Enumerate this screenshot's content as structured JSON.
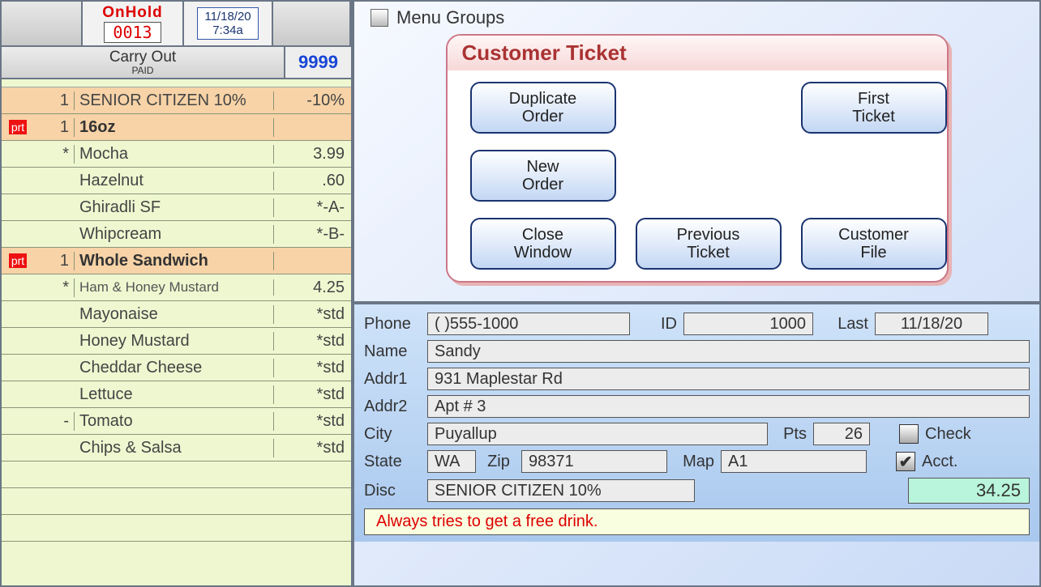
{
  "header": {
    "status": "OnHold",
    "ticket_no": "0013",
    "date": "11/18/20",
    "time": "7:34a"
  },
  "order": {
    "type": "Carry Out",
    "paid": "PAID",
    "code": "9999"
  },
  "lines": [
    {
      "flag": "",
      "qty": "1",
      "name": "SENIOR CITIZEN 10%",
      "price": "-10%",
      "hl": "orange",
      "bold": false
    },
    {
      "flag": "prt",
      "qty": "1",
      "name": "16oz",
      "price": "",
      "hl": "orange",
      "bold": true
    },
    {
      "flag": "",
      "qty": "*",
      "name": "Mocha",
      "price": "3.99",
      "hl": "green",
      "bold": false
    },
    {
      "flag": "",
      "qty": "",
      "name": "Hazelnut",
      "price": ".60",
      "hl": "green",
      "bold": false
    },
    {
      "flag": "",
      "qty": "",
      "name": "Ghiradli SF",
      "price": "*-A-",
      "hl": "green",
      "bold": false
    },
    {
      "flag": "",
      "qty": "",
      "name": "Whipcream",
      "price": "*-B-",
      "hl": "green",
      "bold": false
    },
    {
      "flag": "prt",
      "qty": "1",
      "name": "Whole Sandwich",
      "price": "",
      "hl": "orange",
      "bold": true
    },
    {
      "flag": "",
      "qty": "*",
      "name": "Ham & Honey Mustard",
      "price": "4.25",
      "hl": "green",
      "sub": true
    },
    {
      "flag": "",
      "qty": "",
      "name": "Mayonaise",
      "price": "*std",
      "hl": "green",
      "bold": false
    },
    {
      "flag": "",
      "qty": "",
      "name": "Honey Mustard",
      "price": "*std",
      "hl": "green",
      "bold": false
    },
    {
      "flag": "",
      "qty": "",
      "name": "Cheddar Cheese",
      "price": "*std",
      "hl": "green",
      "bold": false
    },
    {
      "flag": "",
      "qty": "",
      "name": "Lettuce",
      "price": "*std",
      "hl": "green",
      "bold": false
    },
    {
      "flag": "",
      "qty": "-",
      "name": "Tomato",
      "price": "*std",
      "hl": "green",
      "bold": false
    },
    {
      "flag": "",
      "qty": "",
      "name": "Chips & Salsa",
      "price": "*std",
      "hl": "green",
      "bold": false
    },
    {
      "flag": "",
      "qty": "",
      "name": "",
      "price": "",
      "hl": "green"
    },
    {
      "flag": "",
      "qty": "",
      "name": "",
      "price": "",
      "hl": "green"
    },
    {
      "flag": "",
      "qty": "",
      "name": "",
      "price": "",
      "hl": "green"
    }
  ],
  "menu_groups_label": "Menu Groups",
  "ticket_panel": {
    "title": "Customer Ticket",
    "buttons": {
      "dup": "Duplicate\nOrder",
      "first": "First\nTicket",
      "new": "New\nOrder",
      "close": "Close\nWindow",
      "prev": "Previous\nTicket",
      "file": "Customer\nFile"
    }
  },
  "customer": {
    "labels": {
      "phone": "Phone",
      "id": "ID",
      "last": "Last",
      "name": "Name",
      "addr1": "Addr1",
      "addr2": "Addr2",
      "city": "City",
      "pts": "Pts",
      "state": "State",
      "zip": "Zip",
      "map": "Map",
      "disc": "Disc",
      "check": "Check",
      "acct": "Acct."
    },
    "phone": "(      )555-1000",
    "id": "1000",
    "last": "11/18/20",
    "name": "Sandy",
    "addr1": "931 Maplestar Rd",
    "addr2": "Apt # 3",
    "city": "Puyallup",
    "pts": "26",
    "state": "WA",
    "zip": "98371",
    "map": "A1",
    "disc": "SENIOR CITIZEN 10%",
    "check": false,
    "acct": true,
    "amount": "34.25",
    "note": "Always tries to get a free drink."
  }
}
